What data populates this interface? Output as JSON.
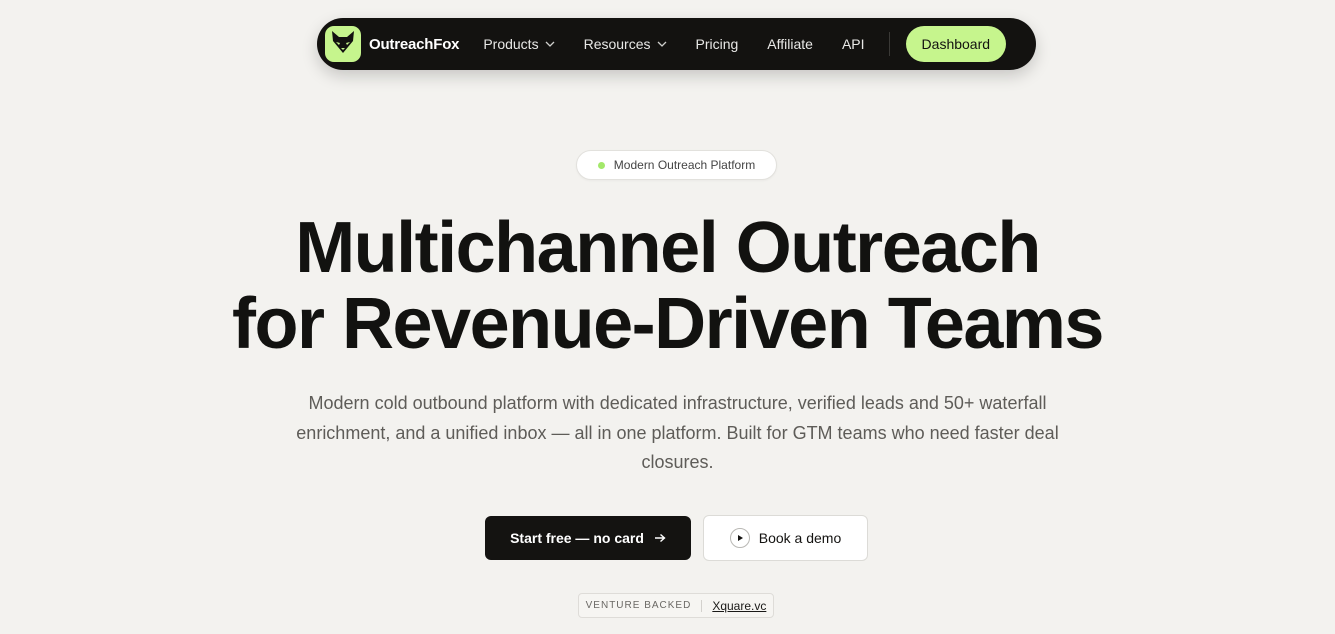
{
  "nav": {
    "brand": "OutreachFox",
    "items": [
      {
        "label": "Products",
        "has_dropdown": true
      },
      {
        "label": "Resources",
        "has_dropdown": true
      },
      {
        "label": "Pricing",
        "has_dropdown": false
      },
      {
        "label": "Affiliate",
        "has_dropdown": false
      },
      {
        "label": "API",
        "has_dropdown": false
      }
    ],
    "cta": "Dashboard",
    "logo_icon": "fox-icon"
  },
  "hero": {
    "badge": "Modern Outreach Platform",
    "headline_line1": "Multichannel Outreach",
    "headline_line2": "for Revenue-Driven Teams",
    "subtitle": "Modern cold outbound platform with dedicated infrastructure, verified leads and 50+ waterfall enrichment, and a unified inbox — all in one platform. Built for GTM teams who need faster deal closures.",
    "primary_cta": "Start free — no card",
    "secondary_cta": "Book a demo",
    "backed_label": "VENTURE BACKED",
    "backed_by": "Xquare.vc"
  },
  "colors": {
    "background": "#f3f2ef",
    "nav_bg": "#131210",
    "accent": "#c6f58d",
    "text_dark": "#121210",
    "text_muted": "#5e5c58"
  }
}
